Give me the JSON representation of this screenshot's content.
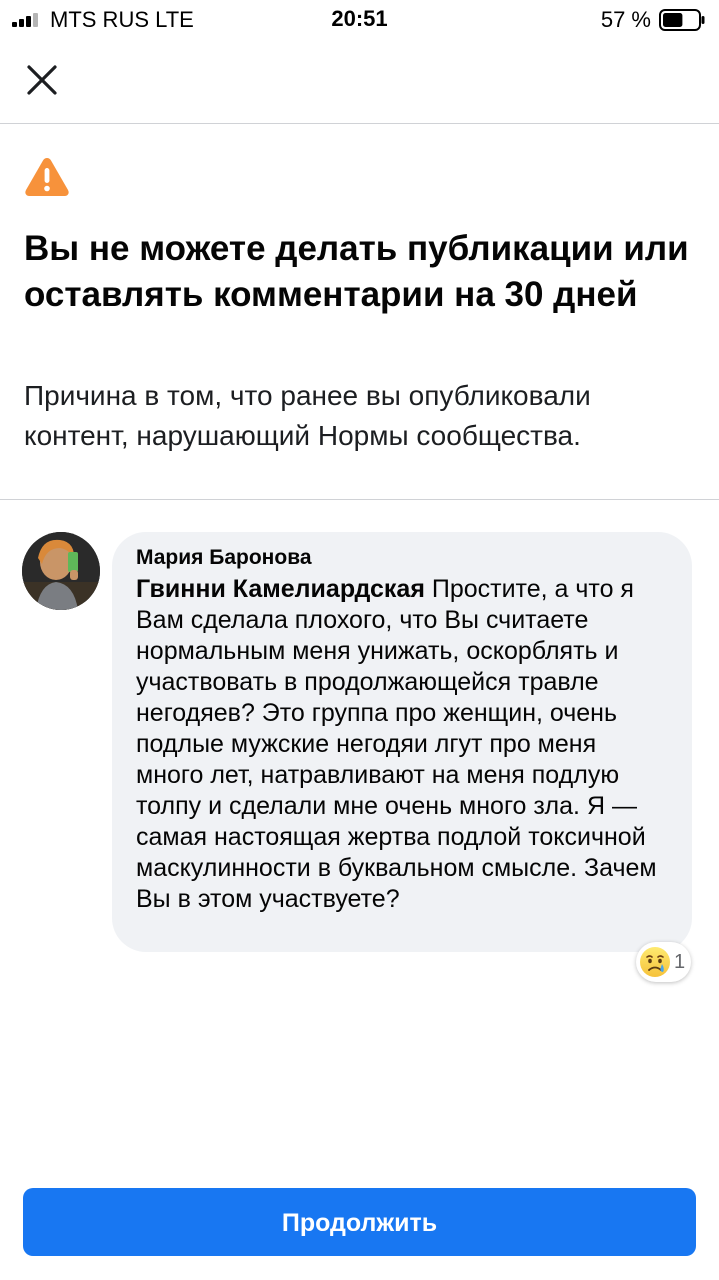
{
  "status_bar": {
    "carrier": "MTS RUS  LTE",
    "time": "20:51",
    "battery_percent": "57 %",
    "battery_level": 0.57,
    "signal_bars": 3
  },
  "header": {
    "close_icon": "close-icon"
  },
  "notice": {
    "icon": "warning-icon",
    "icon_color": "#f7923b",
    "title": "Вы не можете делать публикации или оставлять комментарии на 30 дней",
    "reason": "Причина в том, что ранее вы опубликовали контент, нарушающий Нормы сообщества."
  },
  "comment": {
    "author": "Мария Баронова",
    "mention": "Гвинни Камелиардская",
    "text": " Простите, а что я Вам сделала плохого, что Вы считаете нормальным меня унижать, оскорблять и участвовать в продолжающейся травле негодяев? Это группа про женщин, очень подлые мужские негодяи лгут про меня много лет, натравливают на меня подлую толпу и сделали мне очень много зла. Я — самая настоящая жертва подлой токсичной маскулинности в буквальном смысле. Зачем Вы в этом участвуете?",
    "reaction": {
      "icon": "sad-reaction-icon",
      "count": "1"
    }
  },
  "footer": {
    "continue_label": "Продолжить",
    "button_color": "#1877f2"
  }
}
